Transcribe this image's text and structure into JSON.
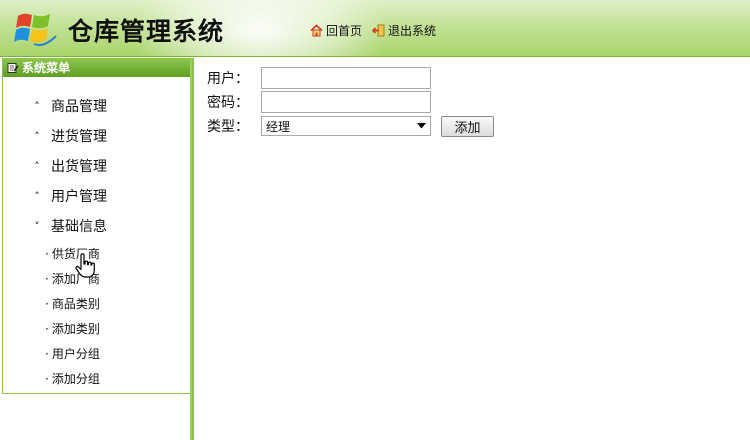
{
  "header": {
    "title": "仓库管理系统",
    "links": [
      {
        "label": "回首页",
        "icon": "home-icon"
      },
      {
        "label": "退出系统",
        "icon": "logout-icon"
      }
    ]
  },
  "sidebar": {
    "head": "系统菜单",
    "items": [
      {
        "label": "商品管理",
        "state": "collapsed"
      },
      {
        "label": "进货管理",
        "state": "collapsed"
      },
      {
        "label": "出货管理",
        "state": "collapsed"
      },
      {
        "label": "用户管理",
        "state": "collapsed"
      },
      {
        "label": "基础信息",
        "state": "expanded"
      }
    ],
    "subitems": [
      {
        "label": "供货厂商"
      },
      {
        "label": "添加厂商"
      },
      {
        "label": "商品类别"
      },
      {
        "label": "添加类别"
      },
      {
        "label": "用户分组"
      },
      {
        "label": "添加分组"
      }
    ]
  },
  "form": {
    "user_label": "用户：",
    "user_value": "",
    "password_label": "密码：",
    "password_value": "",
    "type_label": "类型：",
    "type_selected": "经理",
    "add_button": "添加"
  },
  "colors": {
    "header_green": "#a9d46a",
    "menu_head_green": "#5e9e22",
    "border_green": "#8cc34f"
  }
}
